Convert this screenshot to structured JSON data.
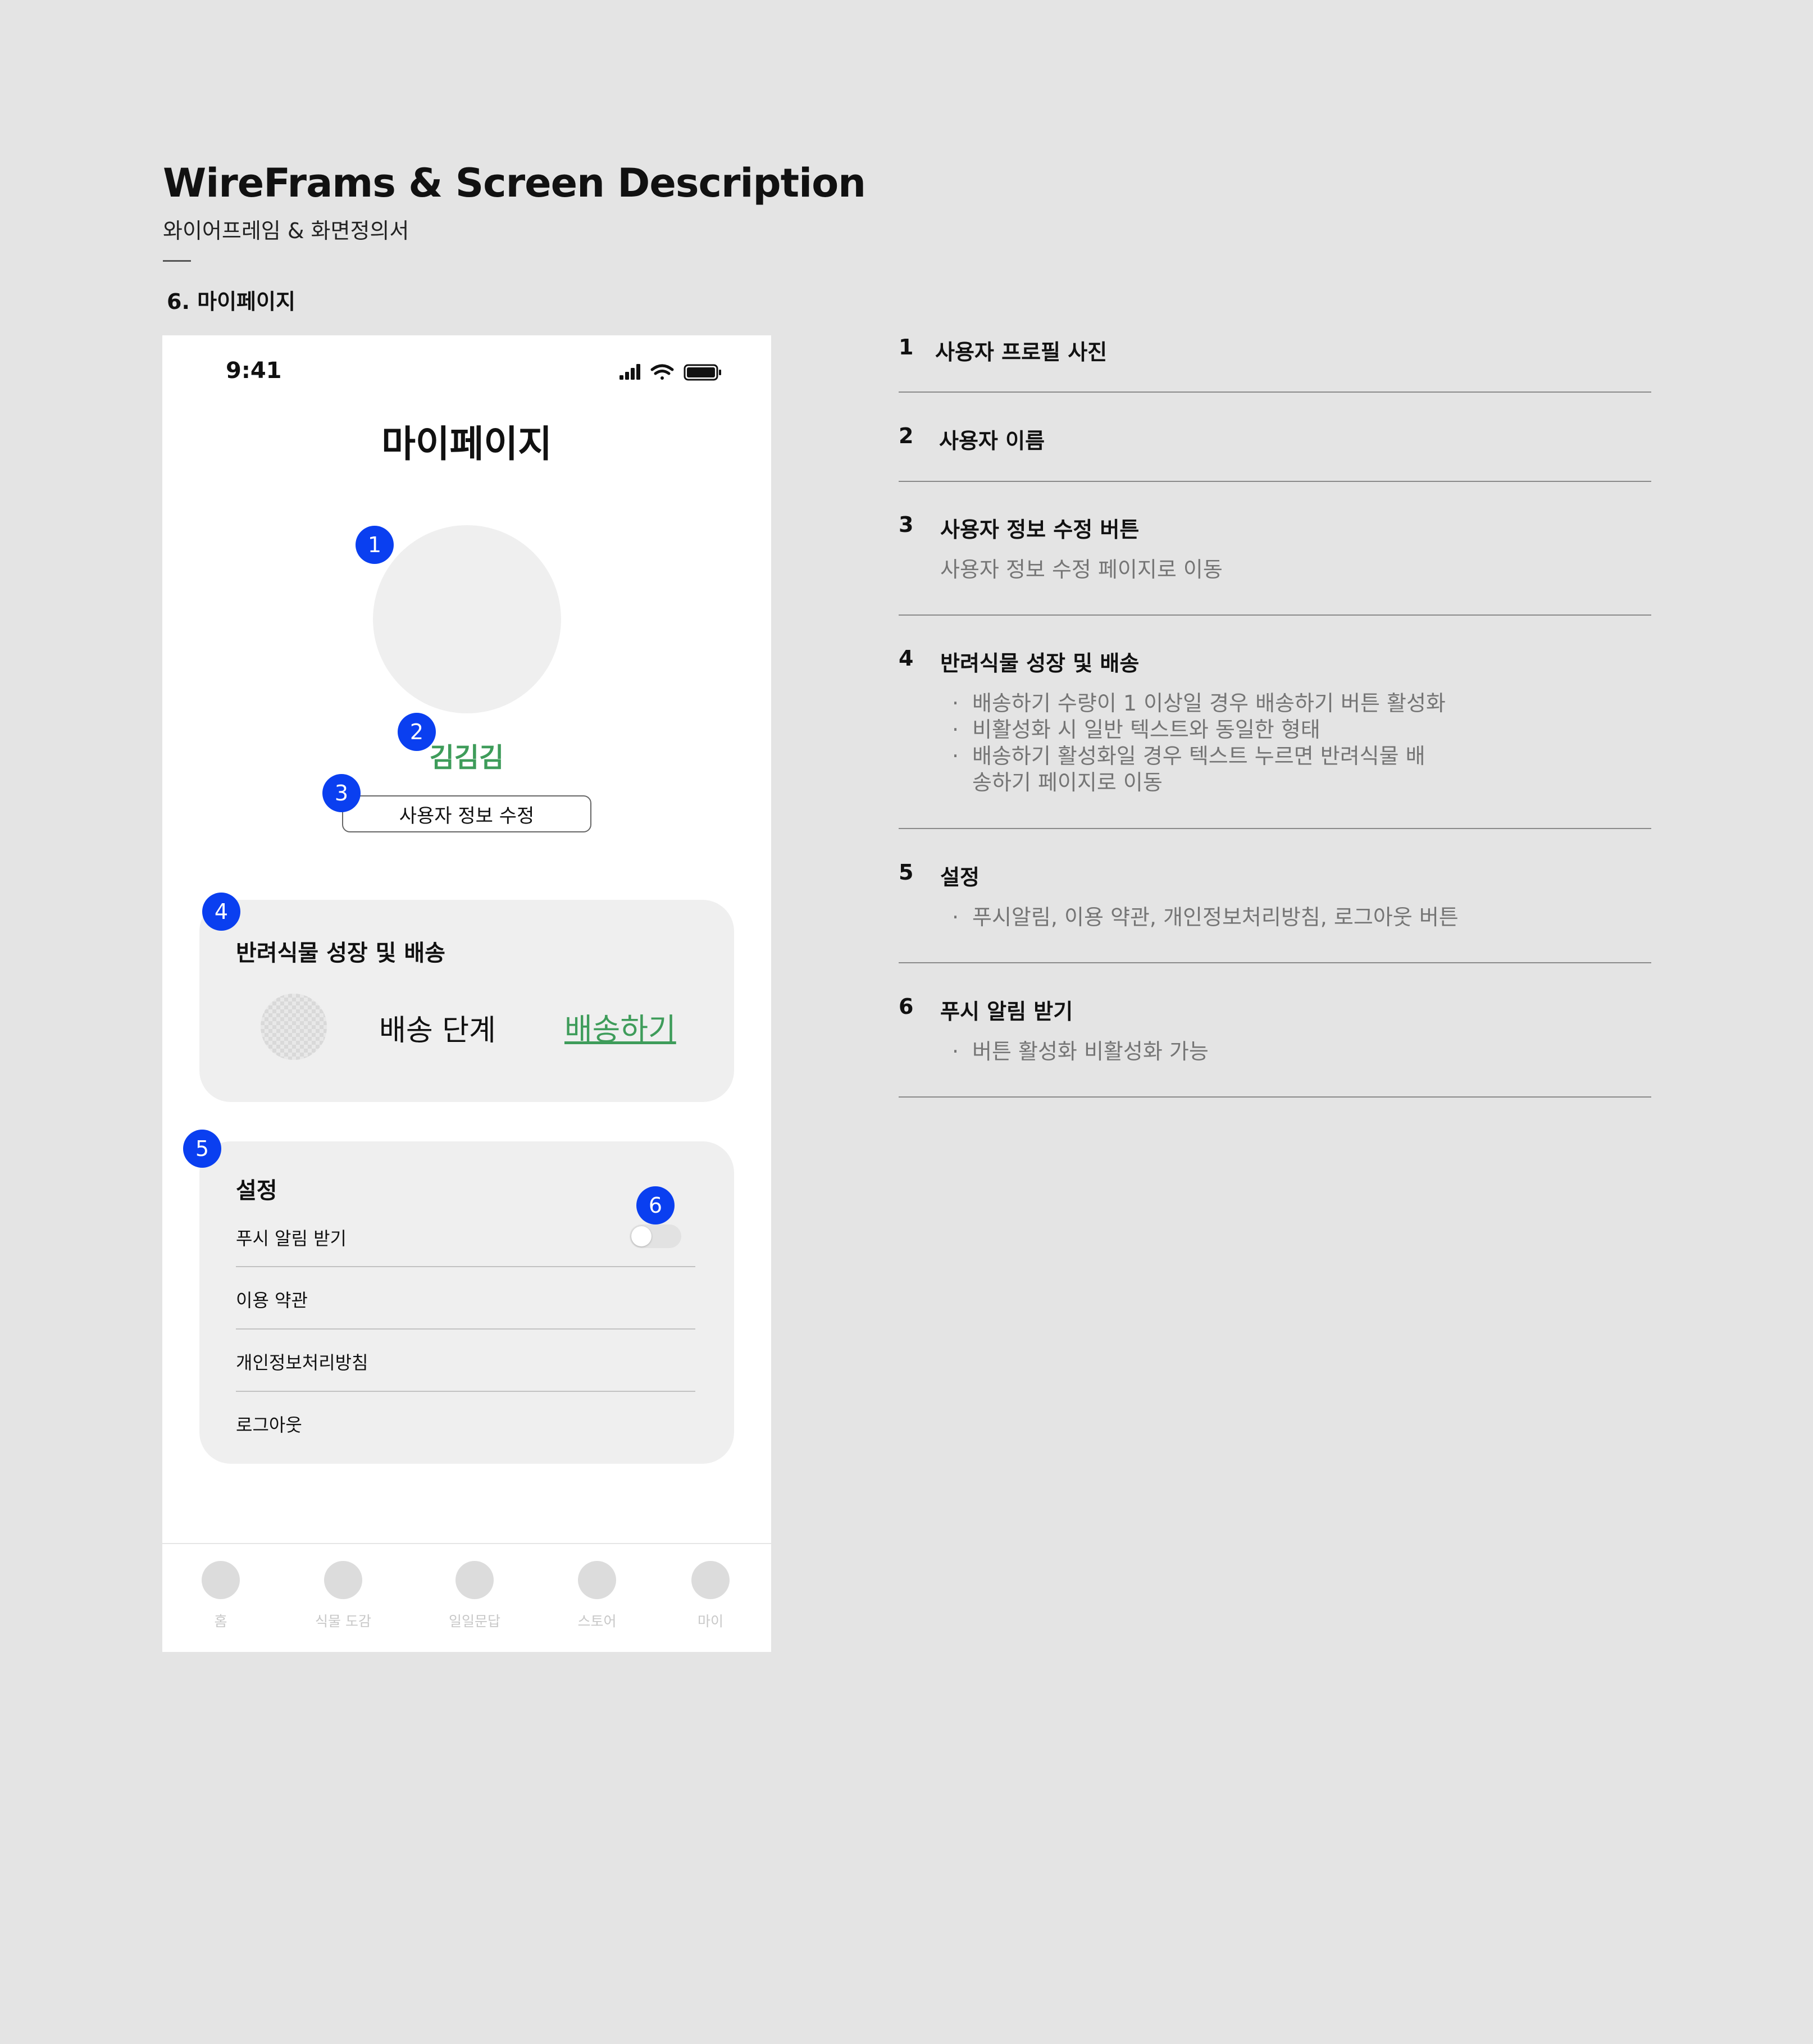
{
  "header": {
    "title": "WireFrams & Screen Description",
    "subtitle": "와이어프레임 & 화면정의서",
    "section": "6. 마이페이지"
  },
  "phone": {
    "status_time": "9:41",
    "title": "마이페이지",
    "user_name": "김김김",
    "edit_button": "사용자 정보 수정",
    "plant_card": {
      "title": "반려식물 성장 및 배송",
      "stage": "배송 단계",
      "ship_link": "배송하기"
    },
    "settings": {
      "title": "설정",
      "push": "푸시 알림 받기",
      "push_enabled": false,
      "terms": "이용 약관",
      "privacy": "개인정보처리방침",
      "logout": "로그아웃"
    },
    "tabs": [
      "홈",
      "식물 도감",
      "일일문답",
      "스토어",
      "마이"
    ]
  },
  "badges": [
    "1",
    "2",
    "3",
    "4",
    "5",
    "6"
  ],
  "descriptions": [
    {
      "num": "1",
      "title": "사용자 프로필 사진"
    },
    {
      "num": "2",
      "title": "사용자 이름"
    },
    {
      "num": "3",
      "title": "사용자 정보 수정 버튼",
      "text": "사용자 정보 수정 페이지로 이동"
    },
    {
      "num": "4",
      "title": "반려식물 성장 및 배송",
      "bullets": [
        "배송하기 수량이 1 이상일 경우 배송하기 버튼 활성화",
        "비활성화 시 일반 텍스트와 동일한 형태",
        "배송하기 활성화일 경우 텍스트 누르면 반려식물 배",
        "송하기 페이지로 이동"
      ]
    },
    {
      "num": "5",
      "title": "설정",
      "bullets": [
        "푸시알림, 이용 약관, 개인정보처리방침, 로그아웃 버튼"
      ]
    },
    {
      "num": "6",
      "title": "푸시 알림 받기",
      "bullets": [
        "버튼 활성화 비활성화 가능"
      ]
    }
  ],
  "colors": {
    "background": "#e4e4e4",
    "badge": "#0a3ff0",
    "accent_green": "#3e9c5a",
    "card": "#efefef"
  },
  "icons": [
    "cellular-signal-icon",
    "wifi-icon",
    "battery-icon"
  ]
}
